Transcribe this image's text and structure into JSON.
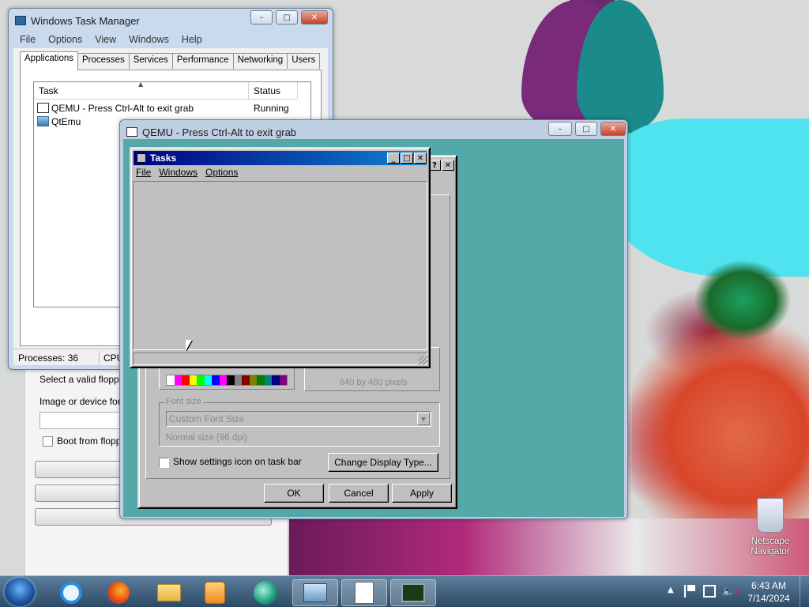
{
  "task_manager": {
    "title": "Windows Task Manager",
    "menu": [
      "File",
      "Options",
      "View",
      "Windows",
      "Help"
    ],
    "tabs": [
      "Applications",
      "Processes",
      "Services",
      "Performance",
      "Networking",
      "Users"
    ],
    "columns": {
      "task": "Task",
      "status": "Status"
    },
    "rows": [
      {
        "task": "QEMU - Press Ctrl-Alt to exit grab",
        "status": "Running"
      },
      {
        "task": "QtEmu",
        "status": ""
      }
    ],
    "processes": "Processes: 36",
    "cpu": "CPU"
  },
  "qtemu_panel": {
    "select_floppy": "Select a valid floppy",
    "image_or_device": "Image or device for t",
    "boot_from_floppy": "Boot from floppy"
  },
  "qemu": {
    "title": "QEMU - Press Ctrl-Alt to exit grab"
  },
  "display_props": {
    "screen_area_text": "640 by 480 pixels",
    "font_size_label": "Font size",
    "font_size_value": "Custom Font Size",
    "font_size_note": "Normal size (96 dpi)",
    "show_settings_icon": "Show settings icon on task bar",
    "change_display_type": "Change Display Type...",
    "ok": "OK",
    "cancel": "Cancel",
    "apply": "Apply",
    "palette": [
      "#ffffff",
      "#ff00ff",
      "#ff0000",
      "#ffff00",
      "#00ff00",
      "#00ffff",
      "#0000ff",
      "#ff00ff",
      "#000000",
      "#808080",
      "#800000",
      "#808000",
      "#008000",
      "#008080",
      "#000080",
      "#800080"
    ]
  },
  "tasks_window": {
    "title": "Tasks",
    "menu": [
      "File",
      "Windows",
      "Options"
    ]
  },
  "desktop": {
    "netscape_label_1": "Netscape",
    "netscape_label_2": "Navigator"
  },
  "taskbar": {
    "time": "6:43 AM",
    "date": "7/14/2024"
  }
}
